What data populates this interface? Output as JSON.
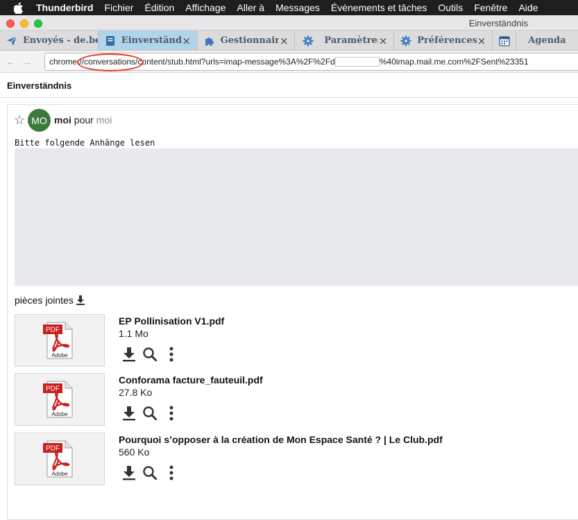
{
  "menubar": {
    "app_name": "Thunderbird",
    "items": [
      "Fichier",
      "Édition",
      "Affichage",
      "Aller à",
      "Messages",
      "Évènements et tâches",
      "Outils",
      "Fenêtre",
      "Aide"
    ]
  },
  "window": {
    "title": "Einverständnis"
  },
  "tabs": [
    {
      "label": "Envoyés - de.berl",
      "icon": "send-icon",
      "closable": false,
      "active": false
    },
    {
      "label": "Einverständnis",
      "icon": "message-icon",
      "closable": true,
      "active": true
    },
    {
      "label": "Gestionnaire d",
      "icon": "puzzle-icon",
      "closable": true,
      "active": false
    },
    {
      "label": "Paramètres",
      "icon": "gear-icon",
      "closable": true,
      "active": false
    },
    {
      "label": "Préférences av",
      "icon": "gear-icon",
      "closable": true,
      "active": false
    },
    {
      "label": "",
      "icon": "calendar-icon",
      "closable": false,
      "active": false
    },
    {
      "label": "Agenda",
      "icon": "",
      "closable": false,
      "active": false
    }
  ],
  "url": {
    "part1": "chrome://conversations/content/stub.html?urls=imap-message%3A%2F%2Fd",
    "part2": "%40imap.mail.me.com%2FSent%23351"
  },
  "conversation": {
    "subject": "Einverständnis"
  },
  "message": {
    "avatar_initials": "MO",
    "from": "moi",
    "to_word": "pour",
    "to": "moi",
    "body": "Bitte folgende Anhänge lesen",
    "attachments_label": "pièces jointes",
    "pdf_label": "PDF",
    "adobe_label": "Adobe",
    "attachments": [
      {
        "name": "EP Pollinisation V1.pdf",
        "size": "1.1 Mo"
      },
      {
        "name": "Conforama facture_fauteuil.pdf",
        "size": "27.8 Ko"
      },
      {
        "name": "Pourquoi s’opposer à la création de Mon Espace Santé ? | Le Club.pdf",
        "size": "560 Ko"
      }
    ]
  },
  "colors": {
    "active_tab": "#b2d4ea",
    "avatar": "#3c7a3c",
    "highlight_circle": "#e03a2a",
    "pdf_red": "#c8201e"
  }
}
